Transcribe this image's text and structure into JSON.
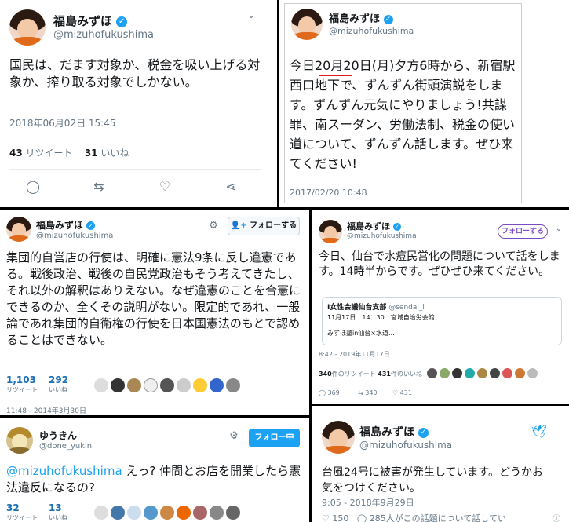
{
  "tweet1": {
    "name": "福島みずほ",
    "handle": "@mizuhofukushima",
    "text": "国民は、だます対象か、税金を吸い上げる対象か、搾り取る対象でしかない。",
    "timestamp": "2018年06月02日 15:45",
    "retweets": "43",
    "retweets_label": "リツイート",
    "likes": "31",
    "likes_label": "いいね"
  },
  "tweet2": {
    "name": "福島みずほ",
    "handle": "@mizuhofukushima",
    "text": "今日20月20日(月)夕方6時から、新宿駅西口地下で、ずんずん街頭演説をします。ずんずん元気にやりましょう!共謀罪、南スーダン、労働法制、税金の使い道について、ずんずん話します。ぜひ来てください!",
    "timestamp": "2017/02/20 10:48"
  },
  "tweet3": {
    "name": "福島みずほ",
    "handle": "@mizuhofukushima",
    "follow_label": "フォローする",
    "text": "集団的自営店の行使は、明確に憲法9条に反し違憲である。戦後政治、戦後の自民党政治もそう考えてきたし、それ以外の解釈はありえない。なぜ違憲のことを合憲にできるのか、全くその説明がない。限定的であれ、一般論であれ集団的自衛権の行使を日本国憲法のもとで認めることはできない。",
    "retweets": "1,103",
    "retweets_label": "リツイート",
    "likes": "292",
    "likes_label": "いいね",
    "timestamp": "11:48 - 2014年3月30日"
  },
  "tweet4": {
    "name": "福島みずほ",
    "handle": "@mizuhofukushima",
    "follow_label": "フォローする",
    "text": "今日、仙台で水痘民営化の問題について話をします。14時半からです。ぜひぜひ来てください。",
    "quote_name": "I女性会議仙台支部",
    "quote_handle": "@sendai_i",
    "quote_line1": "11月17日　14：30　宮城自治労会館",
    "quote_line2": "みずほ塾in仙台×水道...",
    "timestamp": "8:42 - 2019年11月17日",
    "retweets": "340",
    "retweets_label": "件のリツイート",
    "likes": "431",
    "likes_label": "件のいいね",
    "reply_count": "369",
    "rt_count": "340",
    "like_count": "431"
  },
  "tweet5": {
    "name": "ゆうきん",
    "handle": "@done_yukin",
    "follow_label": "フォロー中",
    "mention": "@mizuhofukushima",
    "text": " えっ? 仲間とお店を開業したら憲法違反になるの?",
    "retweets": "32",
    "retweets_label": "リツイート",
    "likes": "13",
    "likes_label": "いいね"
  },
  "tweet6": {
    "name": "福島みずほ",
    "handle": "@mizuhofukushima",
    "text": "台風24号に被害が発生しています。どうかお気をつけください。",
    "timestamp": "9:05 - 2018年9月29日",
    "likes": "150",
    "talking": "285人がこの話題について話してい"
  },
  "colors": {
    "accent": "#1da1f2",
    "follow_orange": "#e8790f",
    "follow_purple": "#794bc4"
  }
}
